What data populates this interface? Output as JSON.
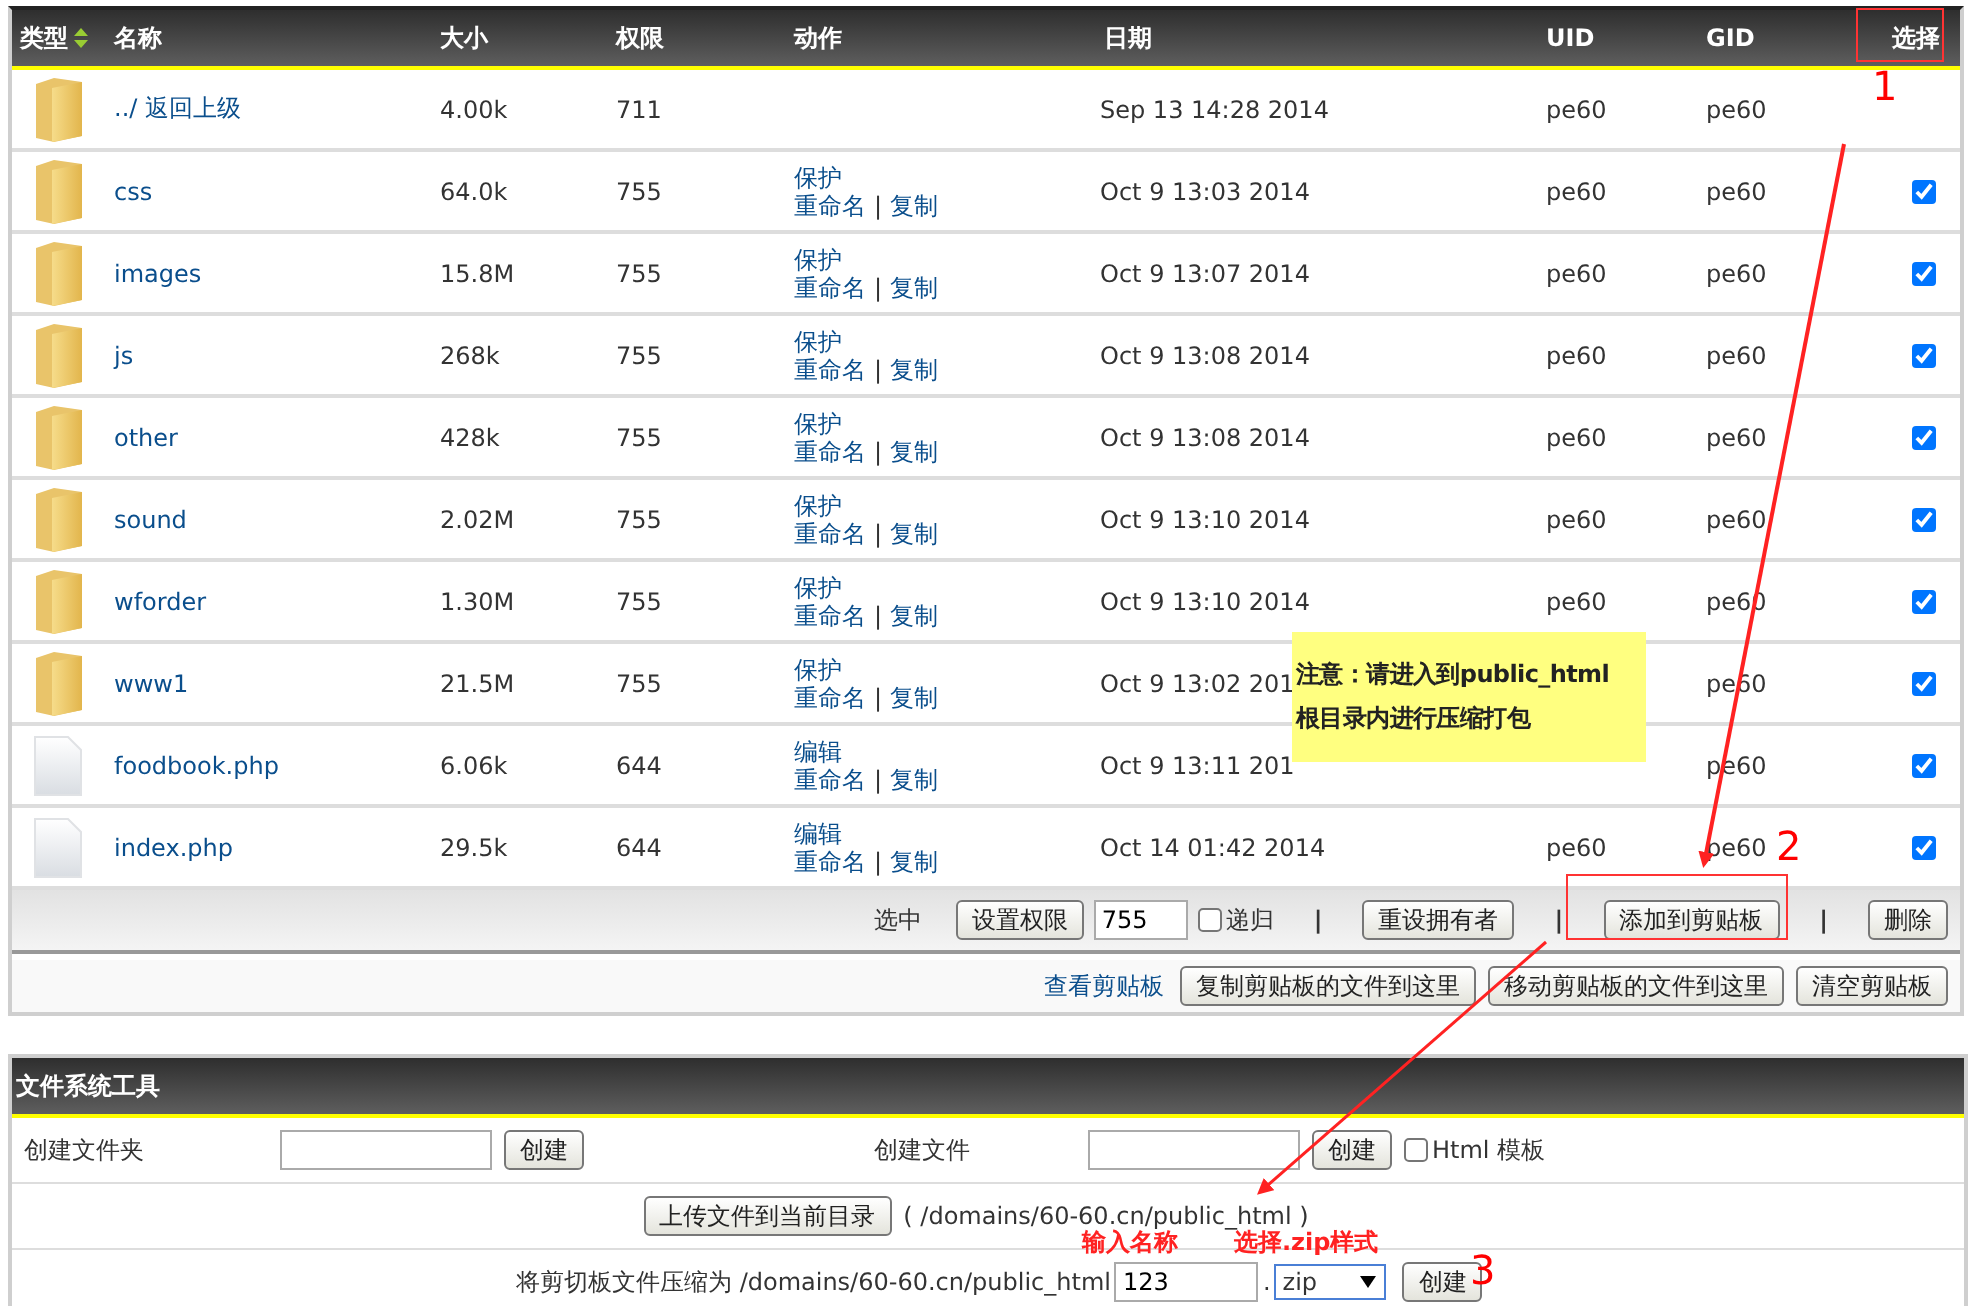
{
  "table": {
    "columns": [
      {
        "label": "类型",
        "sortable": true
      },
      {
        "label": "名称",
        "sortable": false
      },
      {
        "label": "大小",
        "sortable": false
      },
      {
        "label": "权限",
        "sortable": false
      },
      {
        "label": "动作",
        "sortable": false
      },
      {
        "label": "日期",
        "sortable": false
      },
      {
        "label": "UID",
        "sortable": false
      },
      {
        "label": "GID",
        "sortable": false
      },
      {
        "label": "选择",
        "sortable": false
      }
    ],
    "separator": "|",
    "rows": [
      {
        "kind": "folder",
        "name": "../ 返回上级",
        "size": "4.00k",
        "perm": "711",
        "actions": [],
        "date": "Sep 13 14:28 2014",
        "uid": "pe60",
        "gid": "pe60"
      },
      {
        "kind": "folder",
        "name": "css",
        "size": "64.0k",
        "perm": "755",
        "actions": [
          "保护",
          "重命名",
          "复制"
        ],
        "date": "Oct 9 13:03 2014",
        "uid": "pe60",
        "gid": "pe60",
        "checked": true
      },
      {
        "kind": "folder",
        "name": "images",
        "size": "15.8M",
        "perm": "755",
        "actions": [
          "保护",
          "重命名",
          "复制"
        ],
        "date": "Oct 9 13:07 2014",
        "uid": "pe60",
        "gid": "pe60",
        "checked": true
      },
      {
        "kind": "folder",
        "name": "js",
        "size": "268k",
        "perm": "755",
        "actions": [
          "保护",
          "重命名",
          "复制"
        ],
        "date": "Oct 9 13:08 2014",
        "uid": "pe60",
        "gid": "pe60",
        "checked": true
      },
      {
        "kind": "folder",
        "name": "other",
        "size": "428k",
        "perm": "755",
        "actions": [
          "保护",
          "重命名",
          "复制"
        ],
        "date": "Oct 9 13:08 2014",
        "uid": "pe60",
        "gid": "pe60",
        "checked": true
      },
      {
        "kind": "folder",
        "name": "sound",
        "size": "2.02M",
        "perm": "755",
        "actions": [
          "保护",
          "重命名",
          "复制"
        ],
        "date": "Oct 9 13:10 2014",
        "uid": "pe60",
        "gid": "pe60",
        "checked": true
      },
      {
        "kind": "folder",
        "name": "wforder",
        "size": "1.30M",
        "perm": "755",
        "actions": [
          "保护",
          "重命名",
          "复制"
        ],
        "date": "Oct 9 13:10 2014",
        "uid": "pe60",
        "gid": "pe60",
        "checked": true
      },
      {
        "kind": "folder",
        "name": "www1",
        "size": "21.5M",
        "perm": "755",
        "actions": [
          "保护",
          "重命名",
          "复制"
        ],
        "date": "Oct 9 13:02 201",
        "gid": "pe60",
        "checked": true
      },
      {
        "kind": "file",
        "name": "foodbook.php",
        "size": "6.06k",
        "perm": "644",
        "actions": [
          "编辑",
          "重命名",
          "复制"
        ],
        "date": "Oct 9 13:11 201",
        "gid": "pe60",
        "checked": true
      },
      {
        "kind": "file",
        "name": "index.php",
        "size": "29.5k",
        "perm": "644",
        "actions": [
          "编辑",
          "重命名",
          "复制"
        ],
        "date": "Oct 14 01:42 2014",
        "uid": "pe60",
        "gid": "pe60",
        "checked": true
      }
    ]
  },
  "toolbar": {
    "items": [
      {
        "kind": "label",
        "text": "选中"
      },
      {
        "kind": "button",
        "text": "设置权限"
      },
      {
        "kind": "input",
        "value": "755"
      },
      {
        "kind": "checkbox",
        "text": "递归",
        "checked": false
      },
      {
        "kind": "separator",
        "text": "|"
      },
      {
        "kind": "button",
        "text": "重设拥有者"
      },
      {
        "kind": "separator",
        "text": "|"
      },
      {
        "kind": "button",
        "text": "添加到剪贴板"
      },
      {
        "kind": "separator",
        "text": "|"
      },
      {
        "kind": "button",
        "text": "删除"
      }
    ]
  },
  "clipboard_bar": {
    "link": "查看剪贴板",
    "buttons": [
      "复制剪贴板的文件到这里",
      "移动剪贴板的文件到这里",
      "清空剪贴板"
    ]
  },
  "tools": {
    "title": "文件系统工具",
    "create_folder": {
      "label": "创建文件夹",
      "button": "创建"
    },
    "create_file": {
      "label": "创建文件",
      "button": "创建",
      "template": {
        "label": "Html 模板",
        "checked": false
      }
    },
    "upload": {
      "button": "上传文件到当前目录",
      "path": "( /domains/60-60.cn/public_html )"
    },
    "compress": {
      "label": "将剪切板文件压缩为 /domains/60-60.cn/public_html",
      "value": "123",
      "dot": ".",
      "format": "zip",
      "button": "创建"
    }
  },
  "annotations": {
    "note": [
      "注意：请进入到public_html",
      "根目录内进行压缩打包"
    ],
    "markers": [
      "1",
      "2",
      "3"
    ],
    "hints": [
      "输入名称",
      "选择.zip样式"
    ]
  }
}
